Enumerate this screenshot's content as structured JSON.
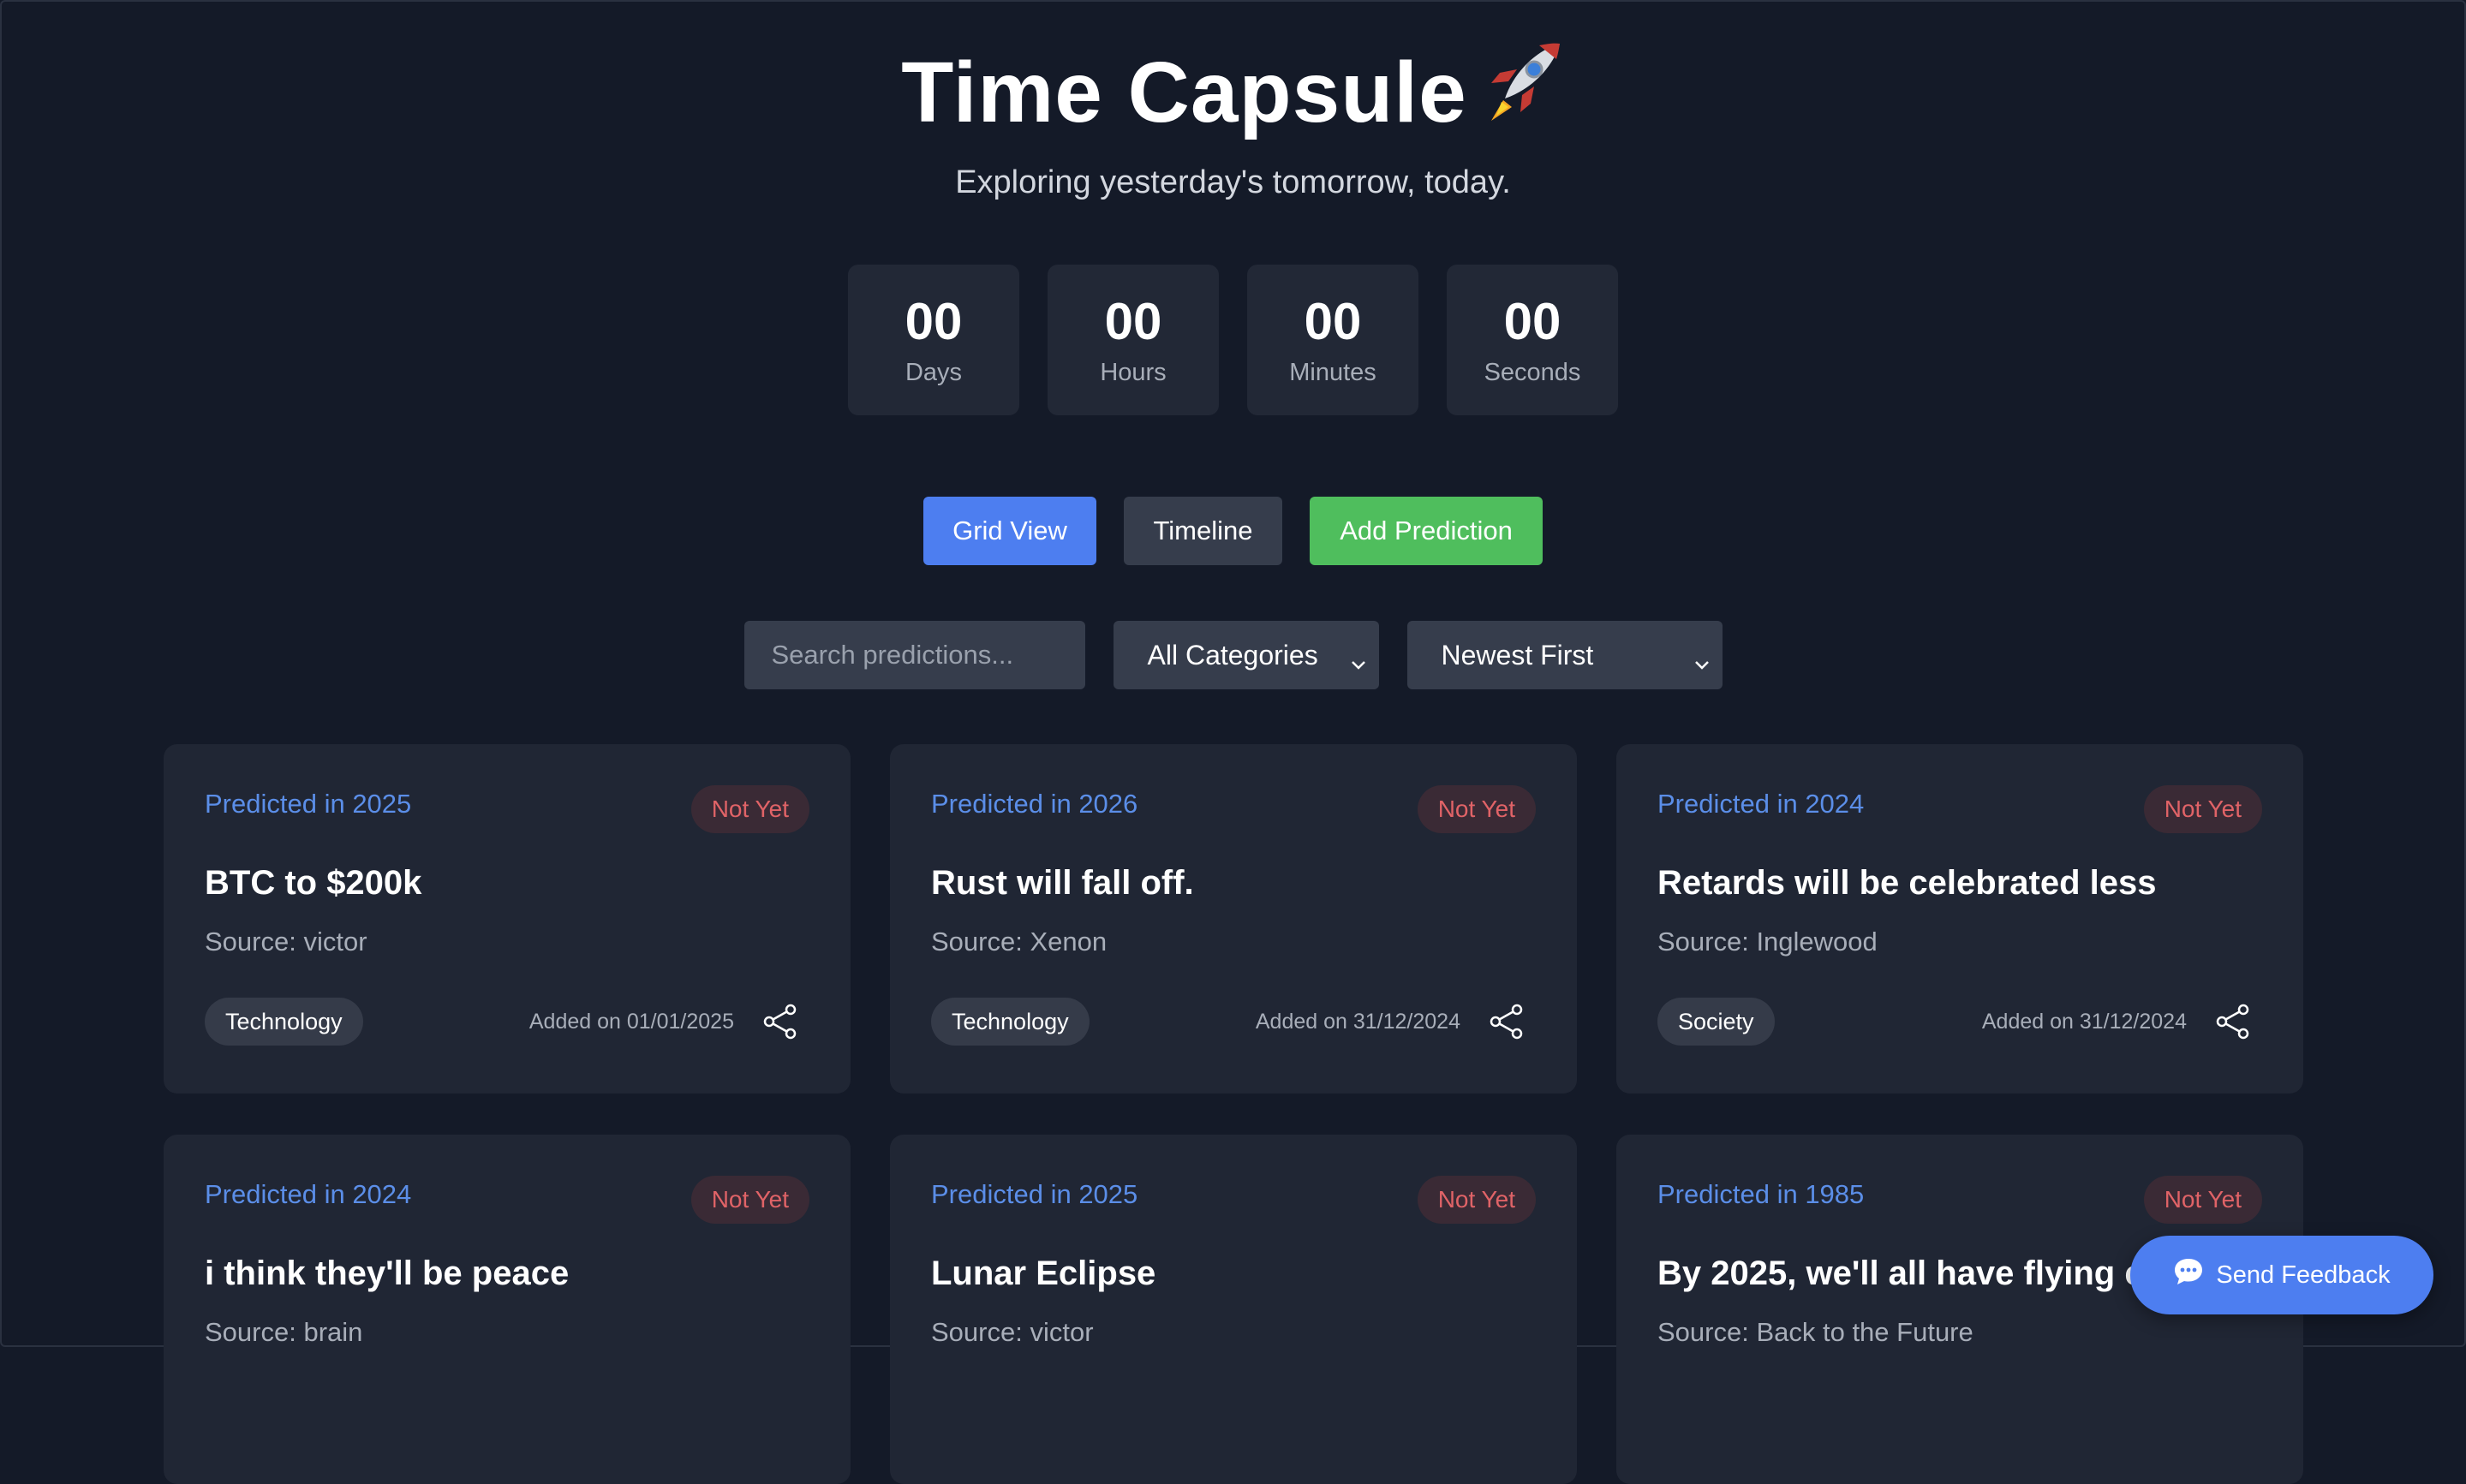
{
  "header": {
    "title": "Time Capsule",
    "subtitle": "Exploring yesterday's tomorrow, today."
  },
  "countdown": [
    {
      "value": "00",
      "label": "Days"
    },
    {
      "value": "00",
      "label": "Hours"
    },
    {
      "value": "00",
      "label": "Minutes"
    },
    {
      "value": "00",
      "label": "Seconds"
    }
  ],
  "actions": {
    "grid_view": "Grid View",
    "timeline": "Timeline",
    "add_prediction": "Add Prediction"
  },
  "filters": {
    "search_placeholder": "Search predictions...",
    "category_selected": "All Categories",
    "sort_selected": "Newest First"
  },
  "cards": [
    {
      "year": "Predicted in 2025",
      "status": "Not Yet",
      "title": "BTC to $200k",
      "source": "Source: victor",
      "category": "Technology",
      "added": "Added on 01/01/2025"
    },
    {
      "year": "Predicted in 2026",
      "status": "Not Yet",
      "title": "Rust will fall off.",
      "source": "Source: Xenon",
      "category": "Technology",
      "added": "Added on 31/12/2024"
    },
    {
      "year": "Predicted in 2024",
      "status": "Not Yet",
      "title": "Retards will be celebrated less",
      "source": "Source: Inglewood",
      "category": "Society",
      "added": "Added on 31/12/2024"
    },
    {
      "year": "Predicted in 2024",
      "status": "Not Yet",
      "title": "i think they'll be peace",
      "source": "Source: brain"
    },
    {
      "year": "Predicted in 2025",
      "status": "Not Yet",
      "title": "Lunar Eclipse",
      "source": "Source: victor"
    },
    {
      "year": "Predicted in 1985",
      "status": "Not Yet",
      "title": "By 2025, we'll all have flying cars",
      "source": "Source: Back to the Future"
    }
  ],
  "feedback": {
    "label": "Send Feedback"
  },
  "colors": {
    "background": "#141a28",
    "card": "#202634",
    "accent_blue": "#4d7ef0",
    "accent_green": "#4fbe5d",
    "year_blue": "#5b8ee8",
    "status_red": "#e06367"
  }
}
